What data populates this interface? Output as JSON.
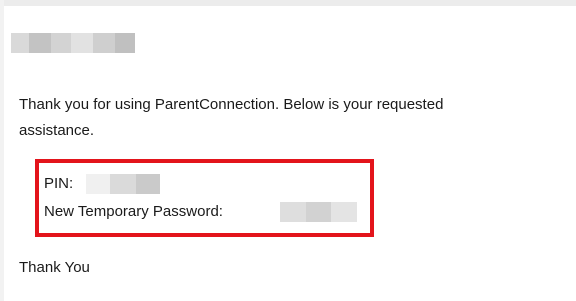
{
  "email": {
    "body_line_1": "Thank you for using ParentConnection. Below is your requested",
    "body_line_2": "assistance.",
    "pin_label": "PIN:",
    "password_label": "New Temporary Password:",
    "closing": "Thank You"
  },
  "colors": {
    "highlight_border": "#e3141b",
    "redaction_light": "#e6e6e6",
    "redaction_mid": "#d4d4d4",
    "redaction_dark": "#c6c6c6"
  }
}
